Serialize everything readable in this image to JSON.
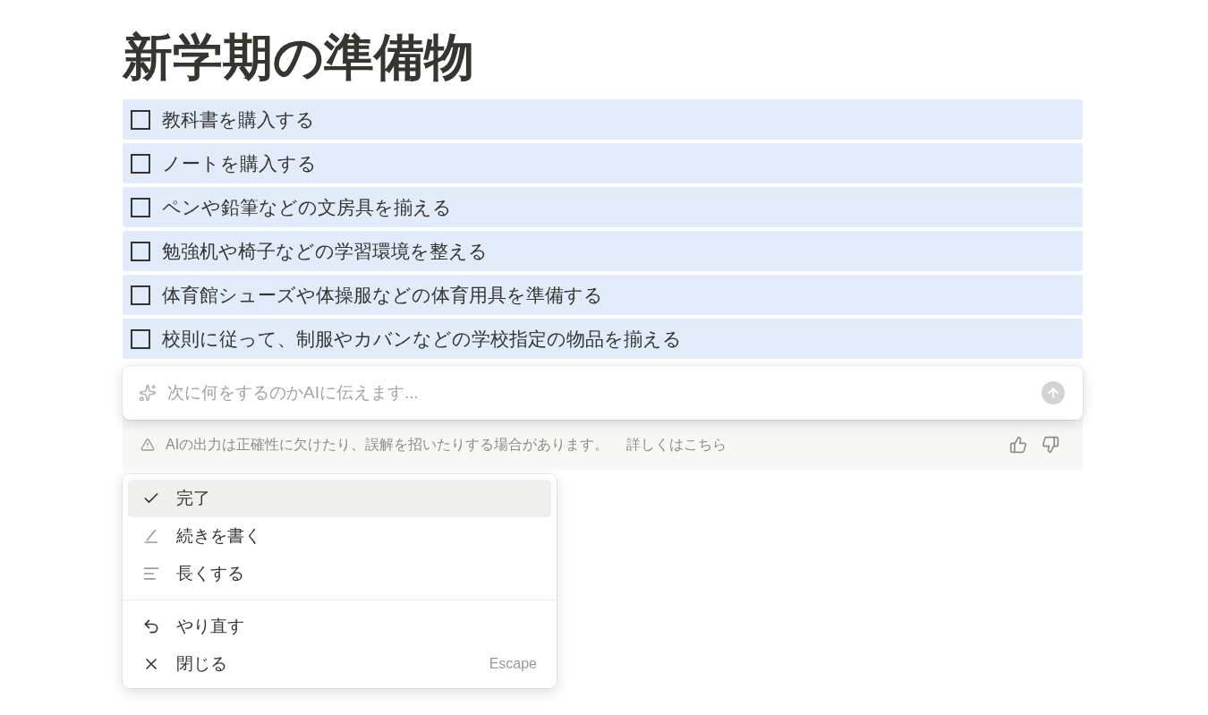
{
  "page": {
    "title": "新学期の準備物"
  },
  "todos": [
    {
      "text": "教科書を購入する",
      "checked": false
    },
    {
      "text": "ノートを購入する",
      "checked": false
    },
    {
      "text": "ペンや鉛筆などの文房具を揃える",
      "checked": false
    },
    {
      "text": "勉強机や椅子などの学習環境を整える",
      "checked": false
    },
    {
      "text": "体育館シューズや体操服などの体育用具を準備する",
      "checked": false
    },
    {
      "text": "校則に従って、制服やカバンなどの学校指定の物品を揃える",
      "checked": false
    }
  ],
  "ai_prompt": {
    "placeholder": "次に何をするのかAIに伝えます...",
    "disclaimer": "AIの出力は正確性に欠けたり、誤解を招いたりする場合があります。",
    "link": "詳しくはこちら"
  },
  "menu": {
    "groups": [
      [
        {
          "kind": "check",
          "label": "完了",
          "selected": true
        },
        {
          "kind": "pencil",
          "label": "続きを書く",
          "selected": false
        },
        {
          "kind": "lines",
          "label": "長くする",
          "selected": false
        }
      ],
      [
        {
          "kind": "undo",
          "label": "やり直す",
          "selected": false
        },
        {
          "kind": "close",
          "label": "閉じる",
          "selected": false,
          "shortcut": "Escape"
        }
      ]
    ]
  }
}
